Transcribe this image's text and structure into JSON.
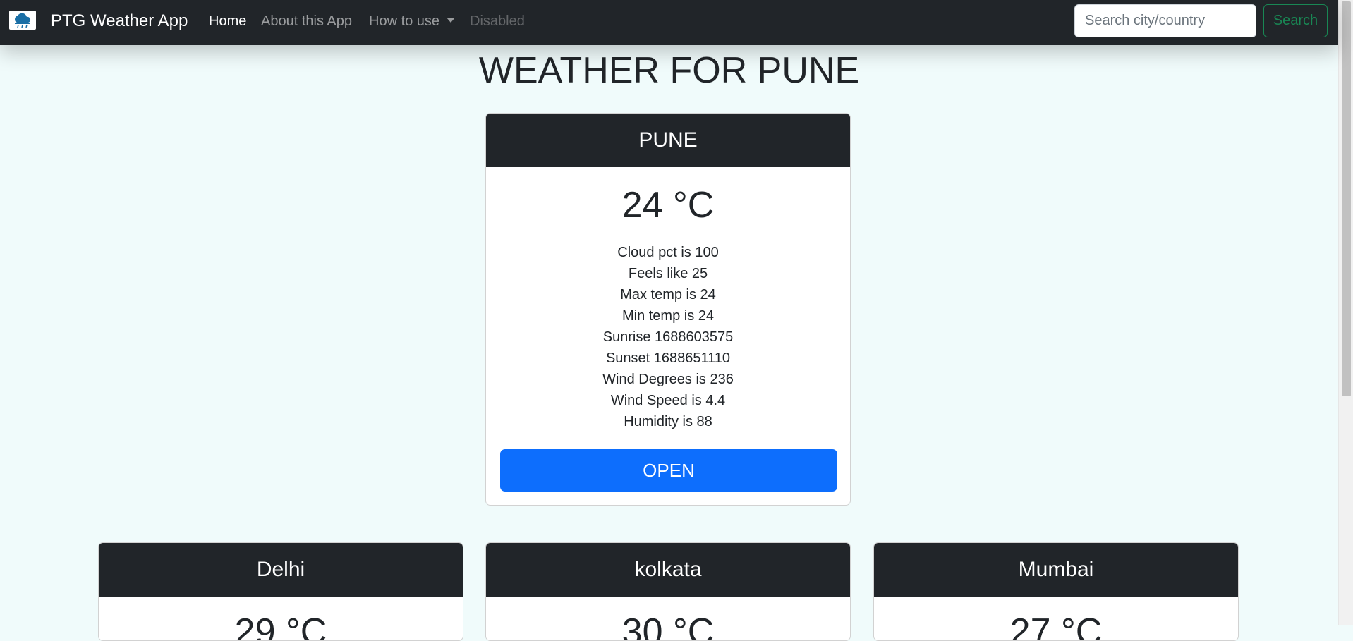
{
  "navbar": {
    "brand_text": "PTG Weather App",
    "logo_icon": "cloud-rain-icon",
    "links": [
      {
        "label": "Home",
        "state": "active"
      },
      {
        "label": "About this App",
        "state": "normal"
      },
      {
        "label": "How to use",
        "state": "dropdown"
      },
      {
        "label": "Disabled",
        "state": "disabled"
      }
    ],
    "search_placeholder": "Search city/country",
    "search_button": "Search"
  },
  "page": {
    "title": "WEATHER FOR PUNE"
  },
  "main_card": {
    "city": "PUNE",
    "temperature": "24 °C",
    "details": [
      "Cloud pct is 100",
      "Feels like 25",
      "Max temp is 24",
      "Min temp is 24",
      "Sunrise 1688603575",
      "Sunset 1688651110",
      "Wind Degrees is 236",
      "Wind Speed is 4.4",
      "Humidity is 88"
    ],
    "open_button": "OPEN"
  },
  "city_cards": [
    {
      "city": "Delhi",
      "temperature": "29 °C"
    },
    {
      "city": "kolkata",
      "temperature": "30 °C"
    },
    {
      "city": "Mumbai",
      "temperature": "27 °C"
    }
  ],
  "colors": {
    "navbar_bg": "#212529",
    "page_bg": "#f0fbfb",
    "primary": "#0d6efd",
    "success": "#198754"
  }
}
